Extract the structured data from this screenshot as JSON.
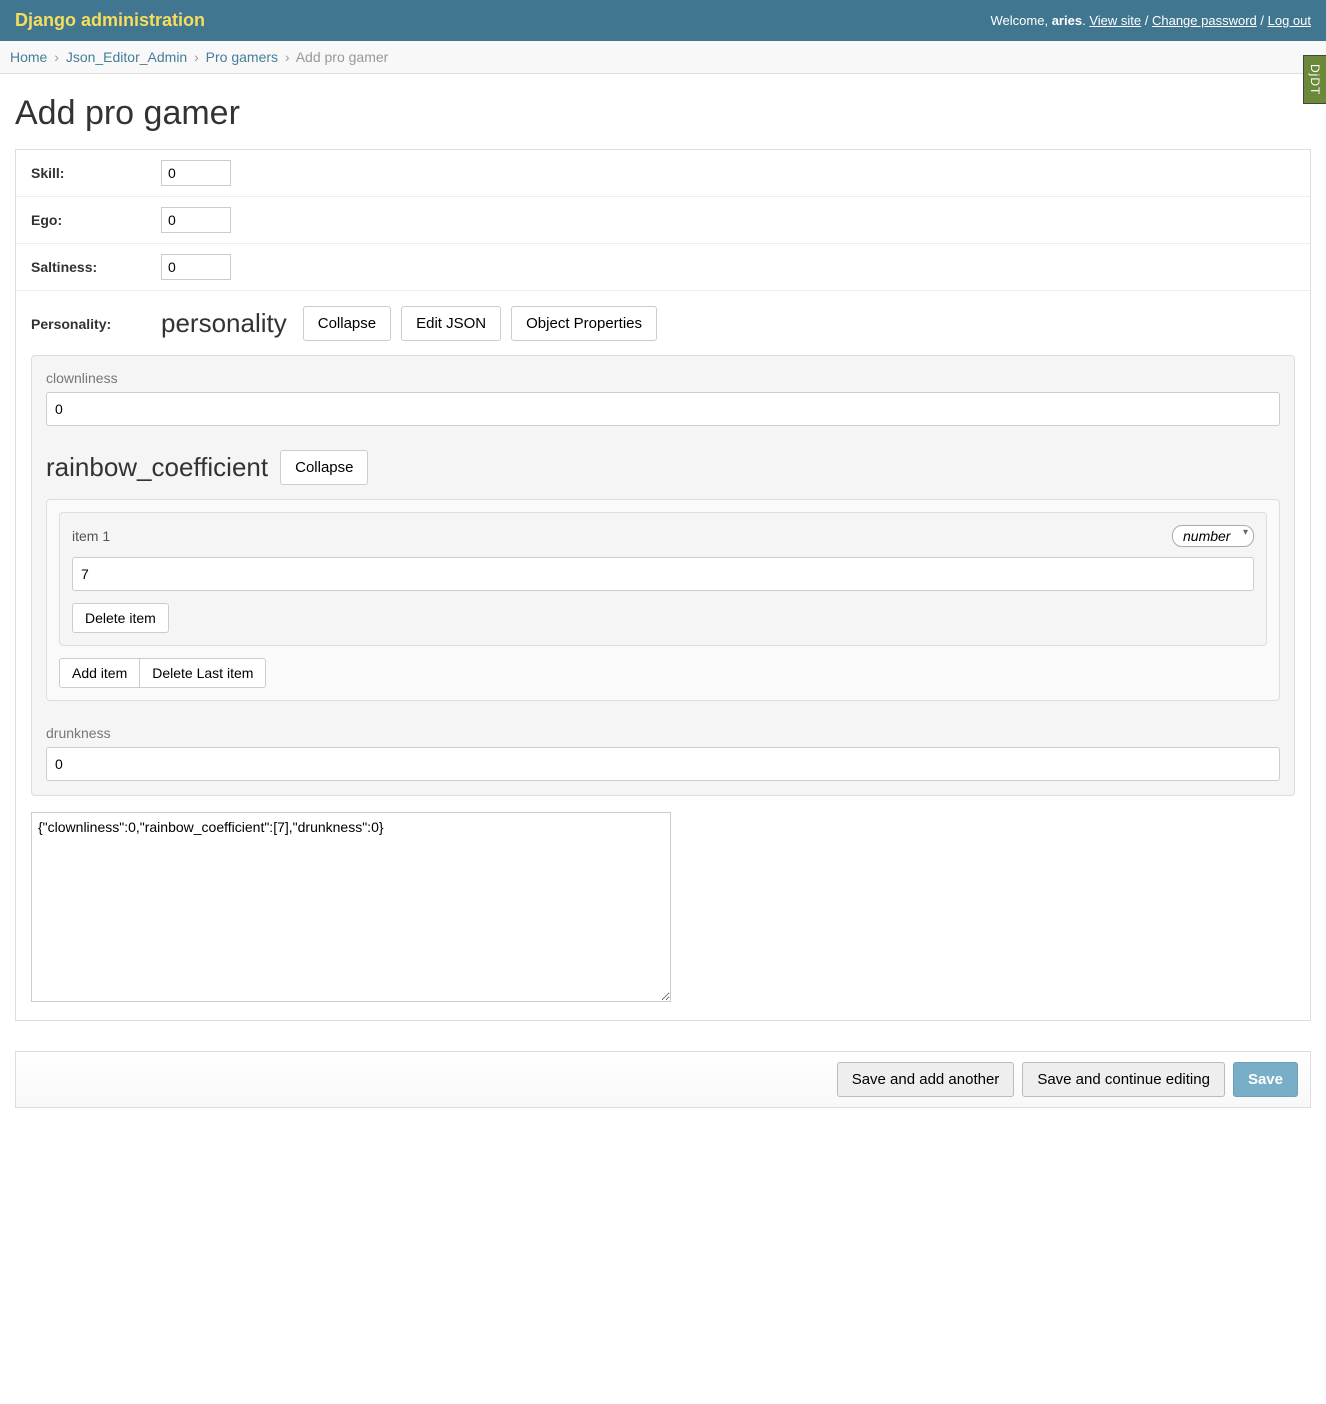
{
  "header": {
    "site_title": "Django administration",
    "welcome": "Welcome,",
    "username": "aries",
    "view_site": "View site",
    "change_password": "Change password",
    "logout": "Log out"
  },
  "djdt": {
    "label": "DjDT"
  },
  "breadcrumbs": {
    "home": "Home",
    "app": "Json_Editor_Admin",
    "model": "Pro gamers",
    "current": "Add pro gamer",
    "sep": "›"
  },
  "page_title": "Add pro gamer",
  "fields": {
    "skill": {
      "label": "Skill:",
      "value": "0"
    },
    "ego": {
      "label": "Ego:",
      "value": "0"
    },
    "saltiness": {
      "label": "Saltiness:",
      "value": "0"
    }
  },
  "personality": {
    "row_label": "Personality:",
    "title": "personality",
    "collapse": "Collapse",
    "edit_json": "Edit JSON",
    "object_properties": "Object Properties",
    "clownliness": {
      "label": "clownliness",
      "value": "0"
    },
    "rainbow": {
      "title": "rainbow_coefficient",
      "collapse": "Collapse",
      "item_label": "item 1",
      "type_option": "number",
      "item_value": "7",
      "delete_item": "Delete item",
      "add_item": "Add item",
      "delete_last": "Delete Last item"
    },
    "drunkness": {
      "label": "drunkness",
      "value": "0"
    },
    "raw_json": "{\"clownliness\":0,\"rainbow_coefficient\":[7],\"drunkness\":0}"
  },
  "submit": {
    "save_add_another": "Save and add another",
    "save_continue": "Save and continue editing",
    "save": "Save"
  }
}
